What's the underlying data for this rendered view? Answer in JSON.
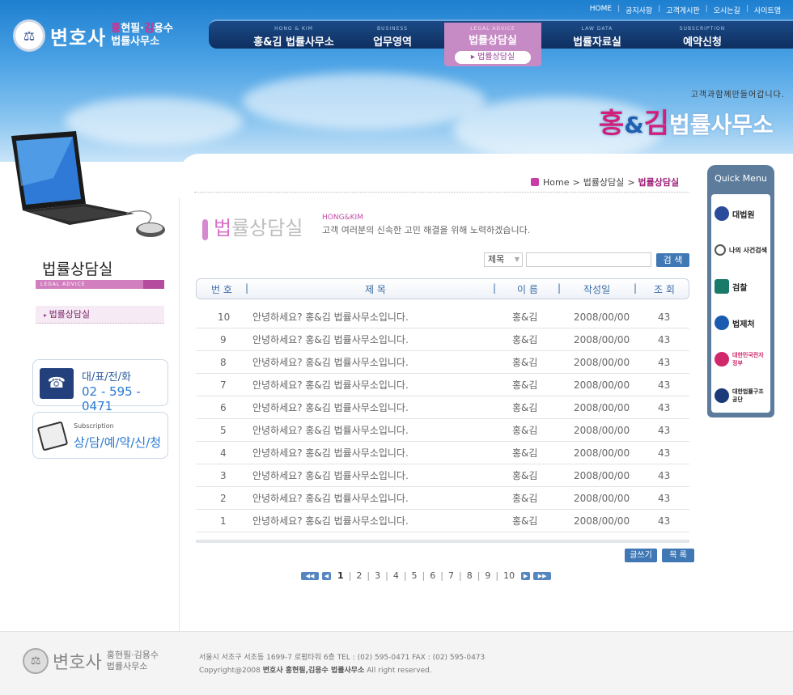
{
  "header": {
    "logo": {
      "main": "변호사",
      "names": "홍현필·김용수",
      "names_h": "홍",
      "names_rest1": "현필·",
      "names_k": "김",
      "names_rest2": "용수",
      "sub": "법률사무소"
    },
    "top_links": [
      "HOME",
      "공지사항",
      "고객게시판",
      "오시는길",
      "사이트맵"
    ],
    "nav": [
      {
        "en": "HONG & KIM",
        "ko": "홍&김 법률사무소"
      },
      {
        "en": "BUSINESS",
        "ko": "업무영역"
      },
      {
        "en": "LEGAL ADVICE",
        "ko": "법률상담실",
        "active": true,
        "sub": "법률상담실"
      },
      {
        "en": "LAW DATA",
        "ko": "법률자료실"
      },
      {
        "en": "SUBSCRIPTION",
        "ko": "예약신청"
      }
    ],
    "slogan": {
      "small": "고객과함께만들어갑니다.",
      "h": "홍",
      "amp": "&",
      "k": "김",
      "rest": "법률사무소"
    }
  },
  "sidebar": {
    "title": "법률상담실",
    "subtitle": "LEGAL ADVICE",
    "menu": [
      "법률상담실"
    ],
    "phone": {
      "label": "대/표/전/화",
      "number": "02 - 595 - 0471"
    },
    "reserve": {
      "en": "Subscription",
      "label": "상/담/예/약/신/청"
    }
  },
  "breadcrumb": {
    "home": "Home",
    "mid": "법률상담실",
    "current": "법률상담실"
  },
  "page": {
    "title_first": "법",
    "title_rest": "률상담실",
    "en": "HONG&KIM",
    "desc": "고객 여러분의 신속한 고민 해결을 위해 노력하겠습니다."
  },
  "search": {
    "select_value": "제목",
    "input_value": "",
    "button": "검 색"
  },
  "table": {
    "headers": [
      "번 호",
      "제 목",
      "이 름",
      "작성일",
      "조 회"
    ],
    "rows": [
      {
        "no": "10",
        "title": "안녕하세요? 홍&김 법률사무소입니다.",
        "name": "홍&김",
        "date": "2008/00/00",
        "views": "43"
      },
      {
        "no": "9",
        "title": "안녕하세요? 홍&김 법률사무소입니다.",
        "name": "홍&김",
        "date": "2008/00/00",
        "views": "43"
      },
      {
        "no": "8",
        "title": "안녕하세요? 홍&김 법률사무소입니다.",
        "name": "홍&김",
        "date": "2008/00/00",
        "views": "43"
      },
      {
        "no": "7",
        "title": "안녕하세요? 홍&김 법률사무소입니다.",
        "name": "홍&김",
        "date": "2008/00/00",
        "views": "43"
      },
      {
        "no": "6",
        "title": "안녕하세요? 홍&김 법률사무소입니다.",
        "name": "홍&김",
        "date": "2008/00/00",
        "views": "43"
      },
      {
        "no": "5",
        "title": "안녕하세요? 홍&김 법률사무소입니다.",
        "name": "홍&김",
        "date": "2008/00/00",
        "views": "43"
      },
      {
        "no": "4",
        "title": "안녕하세요? 홍&김 법률사무소입니다.",
        "name": "홍&김",
        "date": "2008/00/00",
        "views": "43"
      },
      {
        "no": "3",
        "title": "안녕하세요? 홍&김 법률사무소입니다.",
        "name": "홍&김",
        "date": "2008/00/00",
        "views": "43"
      },
      {
        "no": "2",
        "title": "안녕하세요? 홍&김 법률사무소입니다.",
        "name": "홍&김",
        "date": "2008/00/00",
        "views": "43"
      },
      {
        "no": "1",
        "title": "안녕하세요? 홍&김 법률사무소입니다.",
        "name": "홍&김",
        "date": "2008/00/00",
        "views": "43"
      }
    ]
  },
  "buttons": {
    "write": "글쓰기",
    "list": "목 록"
  },
  "pager": {
    "pages": [
      "1",
      "2",
      "3",
      "4",
      "5",
      "6",
      "7",
      "8",
      "9",
      "10"
    ],
    "current": "1"
  },
  "quick_menu": {
    "title": "Quick Menu",
    "items": [
      {
        "label": "대법원",
        "icon": "supreme-court-icon",
        "color": "#2a4a9a"
      },
      {
        "label": "나의 사건검색",
        "icon": "magnifier-icon",
        "color": "#555555"
      },
      {
        "label": "검찰",
        "icon": "prosecution-icon",
        "color": "#1a7a6a"
      },
      {
        "label": "법제처",
        "icon": "legislation-icon",
        "color": "#1a5ab0"
      },
      {
        "label": "대한민국전자정부",
        "icon": "egov-icon",
        "color": "#d0286a"
      },
      {
        "label": "대한법률구조공단",
        "icon": "legal-aid-icon",
        "color": "#1a3a7a"
      }
    ]
  },
  "footer": {
    "logo_main": "변호사",
    "logo_names": "홍현필·김용수",
    "logo_sub": "법률사무소",
    "address": "서울시 서초구 서초동 1699-7 로펌타워 6층   TEL : (02) 595-0471   FAX : (02) 595-0473",
    "copy_prefix": "Copyright@2008",
    "copy_bold": "변호사 홍현필,김용수 법률사무소",
    "copy_suffix": "All right reserved."
  },
  "colors": {
    "accent_pink": "#c68ac4",
    "nav_blue": "#1b4a86",
    "button_blue": "#3f78b4",
    "header_blue": "#4ea4e6"
  }
}
